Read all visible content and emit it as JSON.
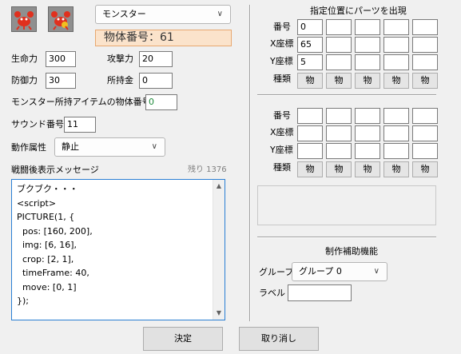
{
  "window": {
    "monster_select": "モンスター",
    "object_number_label": "物体番号：61",
    "buttons": {
      "ok": "決定",
      "cancel": "取り消し"
    }
  },
  "stats": {
    "hp_label": "生命力",
    "hp": "300",
    "attack_label": "攻撃力",
    "attack": "20",
    "defense_label": "防御力",
    "defense": "30",
    "money_label": "所持金",
    "money": "0",
    "item_label": "モンスター所持アイテムの物体番号",
    "item": "0",
    "sound_label": "サウンド番号",
    "sound": "11",
    "action_label": "動作属性",
    "action": "静止"
  },
  "message": {
    "label": "戦闘後表示メッセージ",
    "remaining": "残り 1376",
    "lines": [
      "ブクブク・・・",
      "<script>",
      "PICTURE(1, {",
      "  pos: [160, 200],",
      "  img: [6, 16],",
      "  crop: [2, 1],",
      "  timeFrame: 40,",
      "  move: [0, 1]",
      "});"
    ]
  },
  "parts": {
    "title": "指定位置にパーツを出現",
    "number_label": "番号",
    "x_label": "X座標",
    "y_label": "Y座標",
    "type_label": "種類",
    "type_button": "物",
    "group1": {
      "number": [
        "0",
        "",
        "",
        "",
        ""
      ],
      "x": [
        "65",
        "",
        "",
        "",
        ""
      ],
      "y": [
        "5",
        "",
        "",
        "",
        ""
      ]
    },
    "group2": {
      "number": [
        "",
        "",
        "",
        "",
        ""
      ],
      "x": [
        "",
        "",
        "",
        "",
        ""
      ],
      "y": [
        "",
        "",
        "",
        "",
        ""
      ]
    }
  },
  "assist": {
    "title": "制作補助機能",
    "group_label": "グループ",
    "group_value": "グループ 0",
    "label_label": "ラベル",
    "label_value": ""
  }
}
